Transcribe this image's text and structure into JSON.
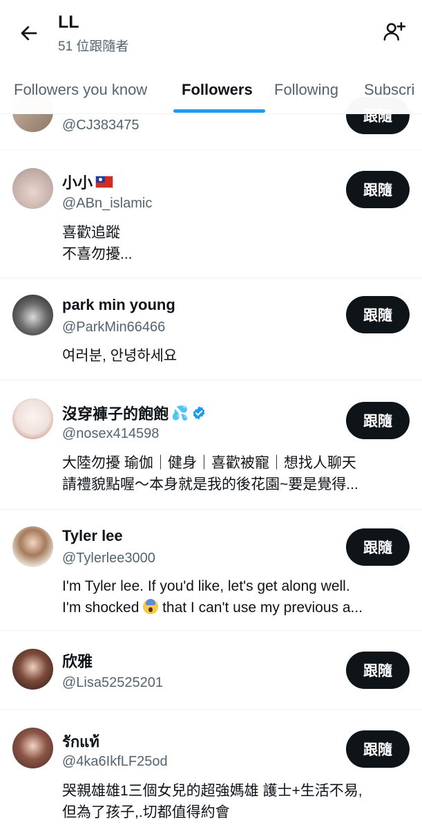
{
  "header": {
    "title": "LL",
    "subtitle": "51 位跟隨者",
    "back_icon": "arrow-left-icon",
    "add_icon": "add-user-icon"
  },
  "tabs": [
    {
      "label": "Followers you know"
    },
    {
      "label": "Followers"
    },
    {
      "label": "Following"
    },
    {
      "label": "Subscri"
    }
  ],
  "follow_label": "跟隨",
  "accounts": [
    {
      "name": "",
      "handle": "@CJ383475",
      "bio": []
    },
    {
      "name": "小小",
      "handle": "@ABn_islamic",
      "bio": [
        "喜歡追蹤",
        "不喜勿擾..."
      ],
      "flag": "taiwan-flag"
    },
    {
      "name": "park min young",
      "handle": "@ParkMin66466",
      "bio": [
        "여러분, 안녕하세요"
      ]
    },
    {
      "name": "沒穿褲子的飽飽",
      "handle": "@nosex414598",
      "bio": [
        "大陸勿擾 瑜伽｜健身｜喜歡被寵｜想找人聊天",
        "請禮貌點喔～本身就是我的後花園~要是覺得..."
      ],
      "verified": true
    },
    {
      "name": "Tyler lee",
      "handle": "@Tylerlee3000",
      "bio": [
        "I'm Tyler lee. If you'd like, let's get along well.",
        "I'm shocked",
        " that I can't use my previous a..."
      ]
    },
    {
      "name": "欣雅",
      "handle": "@Lisa52525201",
      "bio": []
    },
    {
      "name": "รักแท้",
      "handle": "@4ka6IkfLF25od",
      "bio": [
        "哭親雄雄1三個女兒的超強媽雄 護士+生活不易,",
        "但為了孩子,.切都值得約會"
      ]
    }
  ],
  "colors": {
    "accent": "#1d9bf0",
    "button": "#0f1419",
    "secondary_text": "#536471"
  }
}
